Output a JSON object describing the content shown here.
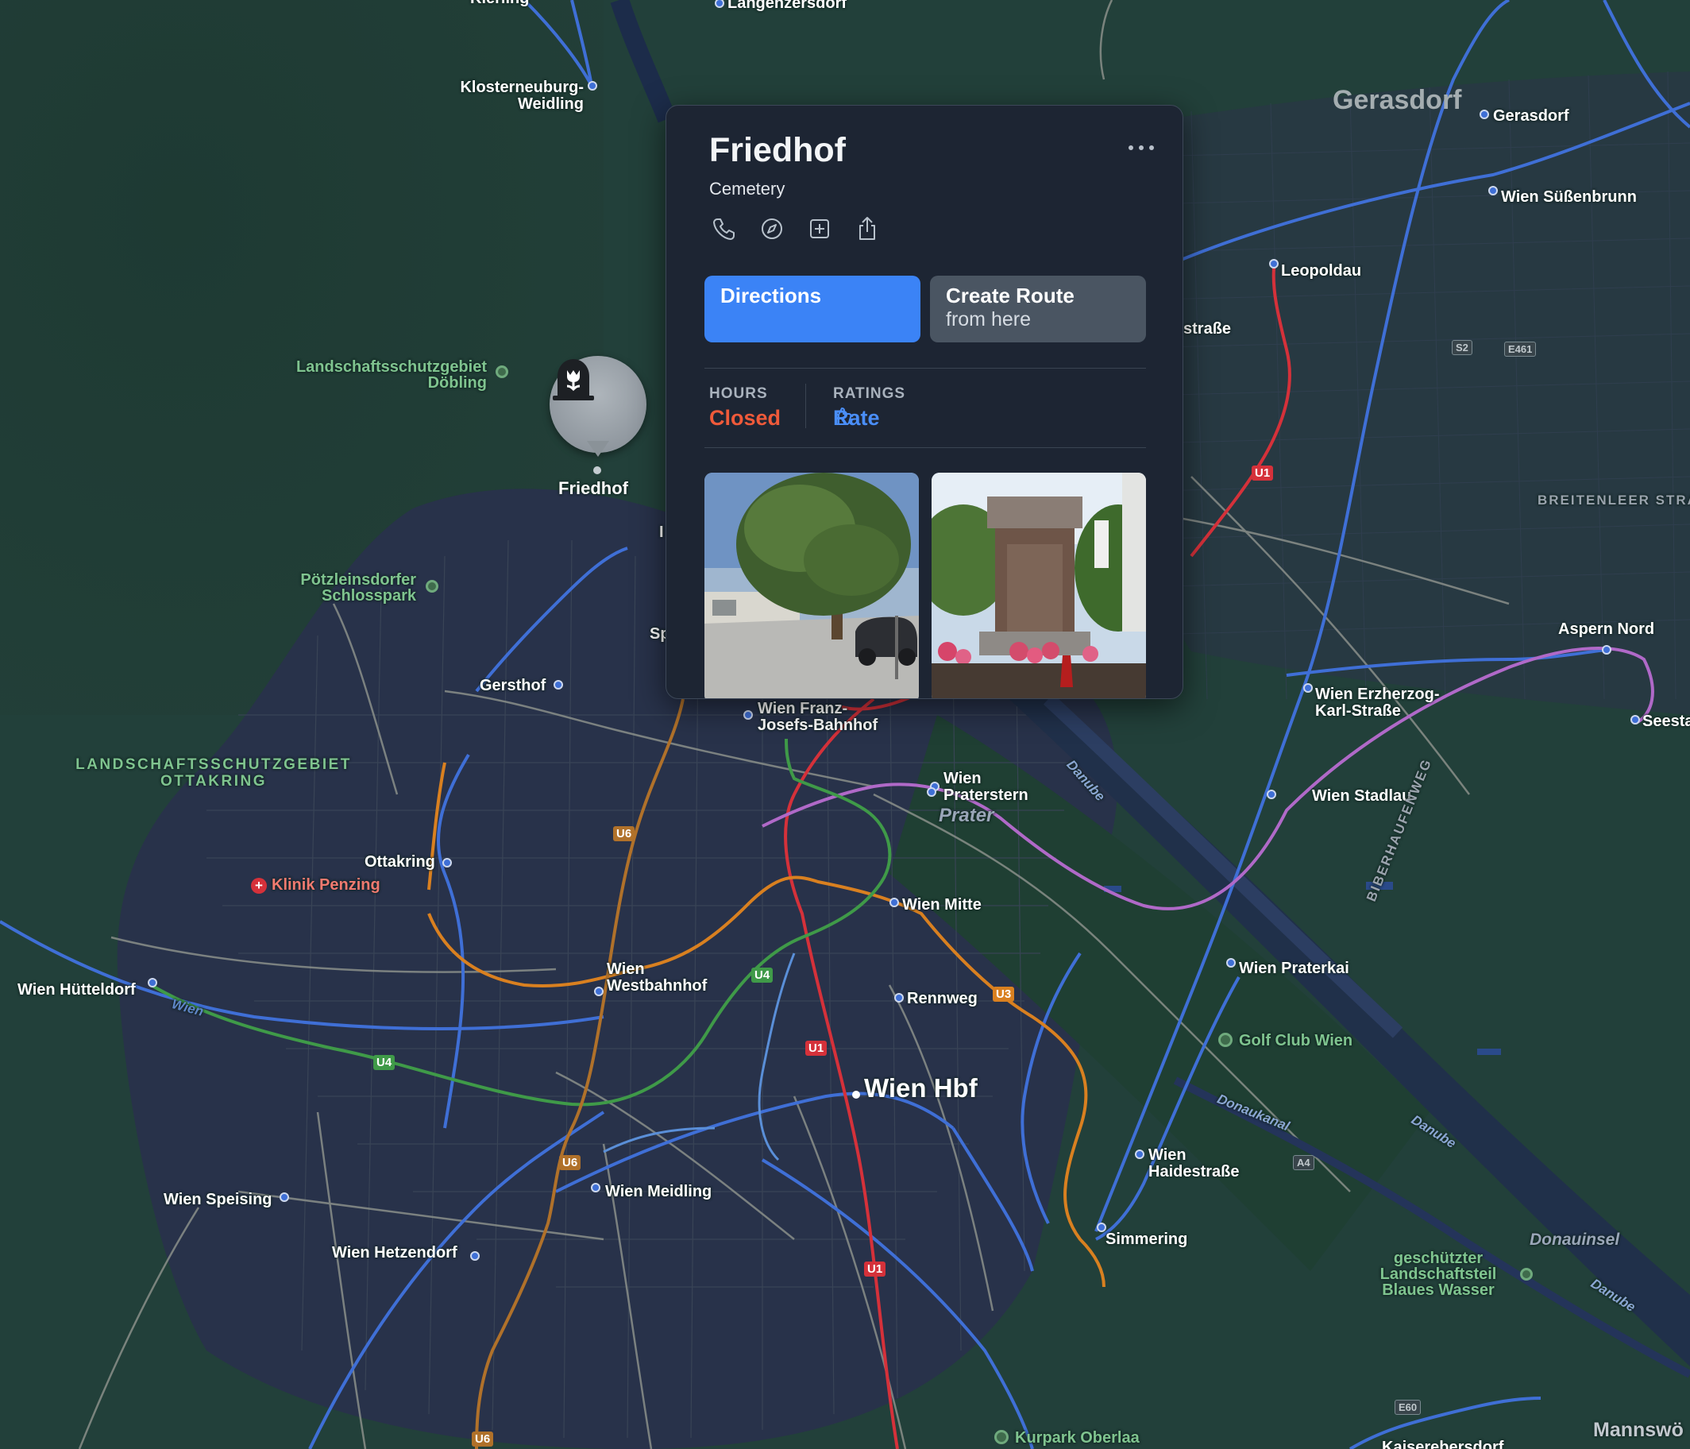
{
  "map": {
    "place_labels": {
      "klosterneuburg": "Klosterneuburg-\nWeidling",
      "langenzersdorf": "Langenzersdorf",
      "kierling": "Kierling",
      "gerasdorf_area": "Gerasdorf",
      "gerasdorf": "Gerasdorf",
      "suessenbrunn": "Wien Süßenbrunn",
      "leopoldau": "Leopoldau",
      "strasse": "straße",
      "gersthof": "Gersthof",
      "franz_josefs": "Wien Franz-\nJosefs-Bahnhof",
      "praterstern": "Wien\nPraterstern",
      "prater": "Prater",
      "ottakring": "Ottakring",
      "huetteldorf": "Wien Hütteldorf",
      "westbahnhof": "Wien\nWestbahnhof",
      "mitte": "Wien Mitte",
      "rennweg": "Rennweg",
      "hbf": "Wien Hbf",
      "meidling": "Wien Meidling",
      "speising": "Wien Speising",
      "hetzendorf": "Wien Hetzendorf",
      "haidestrasse": "Wien\nHaidestraße",
      "simmering": "Simmering",
      "praterkai": "Wien Praterkai",
      "stadlau": "Wien Stadlau",
      "erzherzog": "Wien Erzherzog-\nKarl-Straße",
      "aspern": "Aspern Nord",
      "seestadt": "Seesta",
      "mannswoerth": "Mannswö",
      "kaiserebersdorf": "Kaiserebersdorf",
      "sp": "Sp",
      "i_frag": "I"
    },
    "park_labels": {
      "doebling": "Landschaftsschutzgebiet\nDöbling",
      "poetzleinsdorf": "Pötzleinsdorfer\nSchlosspark",
      "ottakring_park": "LANDSCHAFTSSCHUTZGEBIET\nOTTAKRING",
      "golf": "Golf Club Wien",
      "blaues_wasser": "geschützter\nLandschaftsteil\nBlaues Wasser",
      "kurpark": "Kurpark Oberlaa"
    },
    "other_labels": {
      "klinik": "Klinik Penzing",
      "breitenlee": "BREITENLEER STRA",
      "biberhaufenweg": "BIBERHAUFENWEG",
      "danube1": "Danube",
      "danube2": "Danube",
      "danube3": "Danube",
      "donaukanal": "Donaukanal",
      "donauinsel": "Donauinsel",
      "wien_river": "Wien"
    },
    "shields": {
      "u1_a": "U1",
      "u1_b": "U1",
      "u1_c": "U1",
      "u4_a": "U4",
      "u4_b": "U4",
      "u6_a": "U6",
      "u6_b": "U6",
      "u6_c": "U6",
      "u3": "U3",
      "s2": "S2",
      "e461": "E461",
      "a4": "A4",
      "e60": "E60"
    },
    "pin_label": "Friedhof",
    "colors": {
      "u1": "#d5313a",
      "u3": "#d98020",
      "u4": "#3f9a48",
      "u6": "#b0712a",
      "s_bahn": "#3f6fd6",
      "u2": "#b069c8"
    }
  },
  "card": {
    "title": "Friedhof",
    "category": "Cemetery",
    "actions": [
      "phone-icon",
      "compass-icon",
      "add-icon",
      "share-icon"
    ],
    "directions_label": "Directions",
    "create_route_label": "Create Route",
    "create_route_sub": "from here",
    "hours_label": "HOURS",
    "hours_value": "Closed",
    "ratings_label": "RATINGS",
    "rate_label": "Rate"
  }
}
